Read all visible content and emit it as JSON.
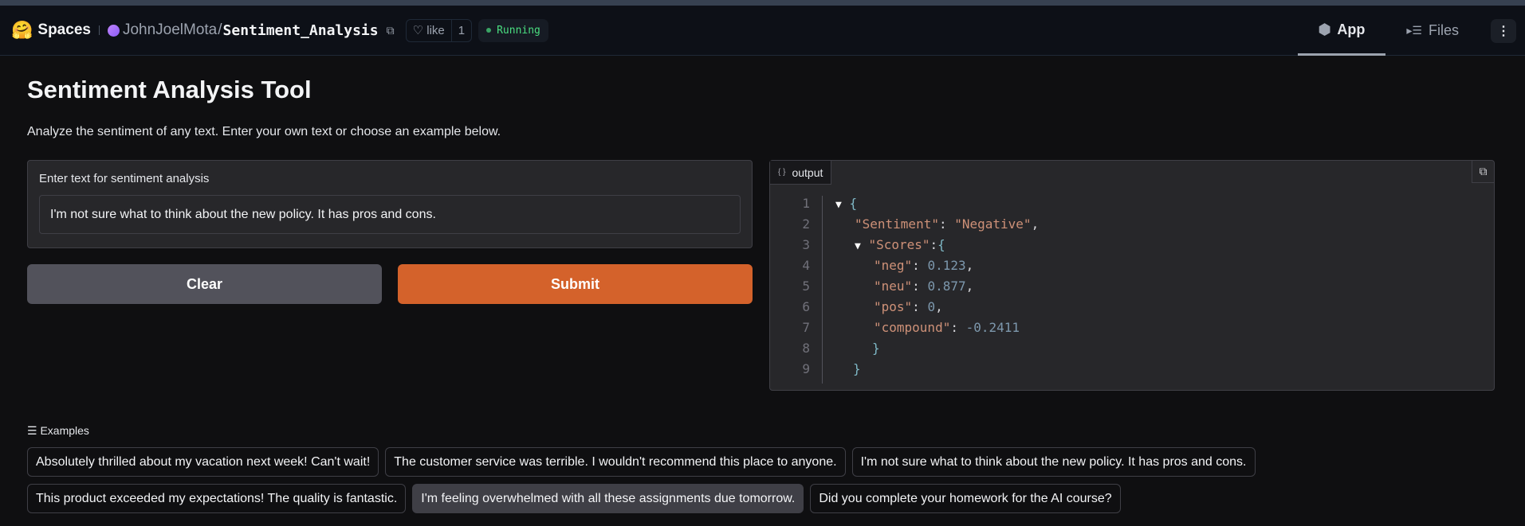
{
  "header": {
    "logo": "🤗",
    "spaces": "Spaces",
    "owner": "JohnJoelMota",
    "slash": "/",
    "repo": "Sentiment_Analysis",
    "like_label": "like",
    "like_count": "1",
    "status": "Running",
    "tabs": [
      {
        "label": "App",
        "icon": "cube-icon"
      },
      {
        "label": "Files",
        "icon": "files-icon"
      }
    ],
    "menu": "⋮"
  },
  "main": {
    "title": "Sentiment Analysis Tool",
    "description": "Analyze the sentiment of any text. Enter your own text or choose an example below.",
    "input": {
      "label": "Enter text for sentiment analysis",
      "value": "I'm not sure what to think about the new policy. It has pros and cons."
    },
    "clear_label": "Clear",
    "submit_label": "Submit"
  },
  "output": {
    "label": "output",
    "lines": [
      "1",
      "2",
      "3",
      "4",
      "5",
      "6",
      "7",
      "8",
      "9"
    ],
    "sentiment_key": "\"Sentiment\"",
    "sentiment_value": "\"Negative\"",
    "scores_key": "\"Scores\"",
    "neg_key": "\"neg\"",
    "neg": "0.123",
    "neu_key": "\"neu\"",
    "neu": "0.877",
    "pos_key": "\"pos\"",
    "pos": "0",
    "compound_key": "\"compound\"",
    "compound": "-0.2411"
  },
  "examples": {
    "label": "Examples",
    "items": [
      "Absolutely thrilled about my vacation next week! Can't wait!",
      "The customer service was terrible. I wouldn't recommend this place to anyone.",
      "I'm not sure what to think about the new policy. It has pros and cons.",
      "This product exceeded my expectations! The quality is fantastic.",
      "I'm feeling overwhelmed with all these assignments due tomorrow.",
      "Did you complete your homework for the AI course?"
    ]
  }
}
